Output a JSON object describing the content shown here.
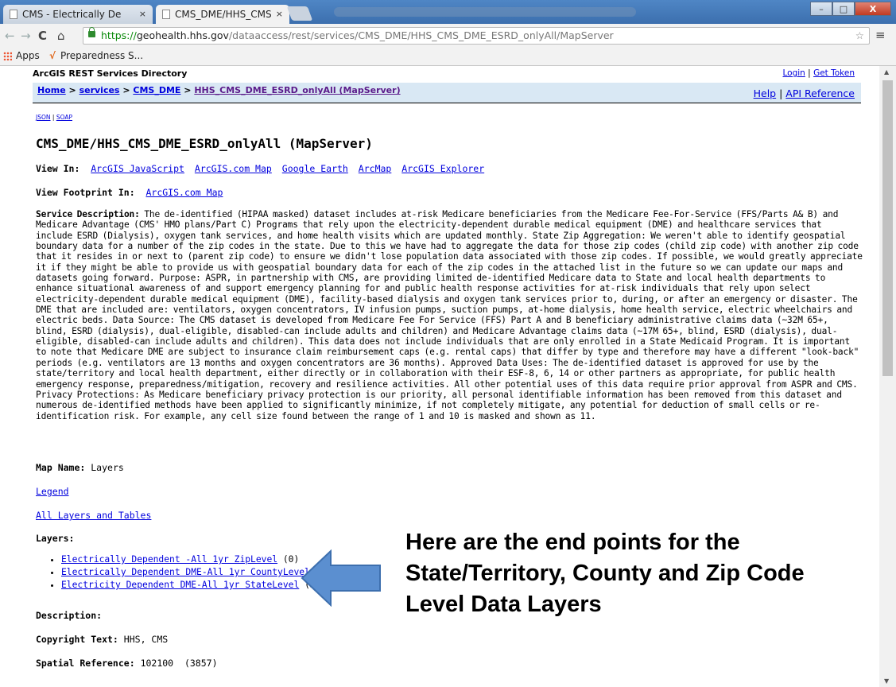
{
  "browser": {
    "tabs": [
      {
        "label": "CMS - Electrically De",
        "close": "×"
      },
      {
        "label": "CMS_DME/HHS_CMS",
        "close": "×"
      }
    ],
    "window_buttons": [
      "–",
      "□",
      "X"
    ],
    "nav_icons": [
      "back-icon",
      "forward-icon",
      "reload-icon",
      "home-icon"
    ],
    "url_scheme": "https://",
    "url_host": "geohealth.hhs.gov",
    "url_path": "/dataaccess/rest/services/CMS_DME/HHS_CMS_DME_ESRD_onlyAll/MapServer",
    "bookmarks": [
      {
        "label": "Apps"
      },
      {
        "label": "Preparedness S..."
      }
    ]
  },
  "page": {
    "directory_title": "ArcGIS REST Services Directory",
    "login": "Login",
    "get_token": "Get Token",
    "sep": "|",
    "breadcrumb": {
      "home": "Home",
      "services": "services",
      "folder": "CMS_DME",
      "current": "HHS_CMS_DME_ESRD_onlyAll (MapServer)",
      "separator": " > "
    },
    "help": "Help",
    "api_reference": "API Reference",
    "json": "JSON",
    "soap": "SOAP",
    "heading": "CMS_DME/HHS_CMS_DME_ESRD_onlyAll (MapServer)",
    "view_in_label": "View In:",
    "view_in_links": [
      "ArcGIS JavaScript",
      "ArcGIS.com Map",
      "Google Earth",
      "ArcMap",
      "ArcGIS Explorer"
    ],
    "view_footprint_label": "View Footprint In:",
    "view_footprint_link": "ArcGIS.com Map",
    "service_description_label": "Service Description:",
    "service_description": "The de-identified (HIPAA masked) dataset includes at-risk Medicare beneficiaries from the Medicare Fee-For-Service (FFS/Parts A& B) and Medicare Advantage (CMS' HMO plans/Part C) Programs that rely upon the electricity-dependent durable medical equipment (DME) and healthcare services that include ESRD (Dialysis), oxygen tank services, and home health visits which are updated monthly. State Zip Aggregation: We weren't able to identify geospatial boundary data for a number of the zip codes in the state. Due to this we have had to aggregate the data for those zip codes (child zip code) with another zip code that it resides in or next to (parent zip code) to ensure we didn't lose population data associated with those zip codes. If possible, we would greatly appreciate it if they might be able to provide us with geospatial boundary data for each of the zip codes in the attached list in the future so we can update our maps and datasets going forward. Purpose: ASPR, in partnership with CMS, are providing limited de-identified Medicare data to State and local health departments to enhance situational awareness of and support emergency planning for and public health response activities for at-risk individuals that rely upon select electricity-dependent durable medical equipment (DME), facility-based dialysis and oxygen tank services prior to, during, or after an emergency or disaster. The DME that are included are: ventilators, oxygen concentrators, IV infusion pumps, suction pumps, at-home dialysis, home health service, electric wheelchairs and electric beds. Data Source: The CMS dataset is developed from Medicare Fee For Service (FFS) Part A and B beneficiary administrative claims data (~32M 65+, blind, ESRD (dialysis), dual-eligible, disabled-can include adults and children) and Medicare Advantage claims data (~17M 65+, blind, ESRD (dialysis), dual-eligible, disabled-can include adults and children). This data does not include individuals that are only enrolled in a State Medicaid Program. It is important to note that Medicare DME are subject to insurance claim reimbursement caps (e.g. rental caps) that differ by type and therefore may have a different \"look-back\" periods (e.g. ventilators are 13 months and oxygen concentrators are 36 months). Approved Data Uses: The de-identified dataset is approved for use by the state/territory and local health department, either directly or in collaboration with their ESF-8, 6, 14 or other partners as appropriate, for public health emergency response, preparedness/mitigation, recovery and resilience activities. All other potential uses of this data require prior approval from ASPR and CMS. Privacy Protections: As Medicare beneficiary privacy protection is our priority, all personal identifiable information has been removed from this dataset and numerous de-identified methods have been applied to significantly minimize, if not completely mitigate, any potential for deduction of small cells or re-identification risk. For example, any cell size found between the range of 1 and 10 is masked and shown as 11.",
    "map_name_label": "Map Name:",
    "map_name": "Layers",
    "legend": "Legend",
    "all_layers": "All Layers and Tables",
    "layers_label": "Layers:",
    "layers": [
      {
        "name": "Electrically Dependent -All 1yr ZipLevel",
        "id": "(0)"
      },
      {
        "name": "Electrically Dependent DME-All 1yr CountyLevel",
        "id": "(1)"
      },
      {
        "name": "Electricity Dependent DME-All 1yr StateLevel",
        "id": "(2)"
      }
    ],
    "description_label": "Description:",
    "copyright_label": "Copyright Text:",
    "copyright": "HHS, CMS",
    "spatial_ref_label": "Spatial Reference:",
    "spatial_ref": "102100  (3857)"
  },
  "callout": {
    "text": "Here are the end points for the State/Territory, County and Zip Code Level Data Layers",
    "arrow_color": "#5b8fd0"
  }
}
